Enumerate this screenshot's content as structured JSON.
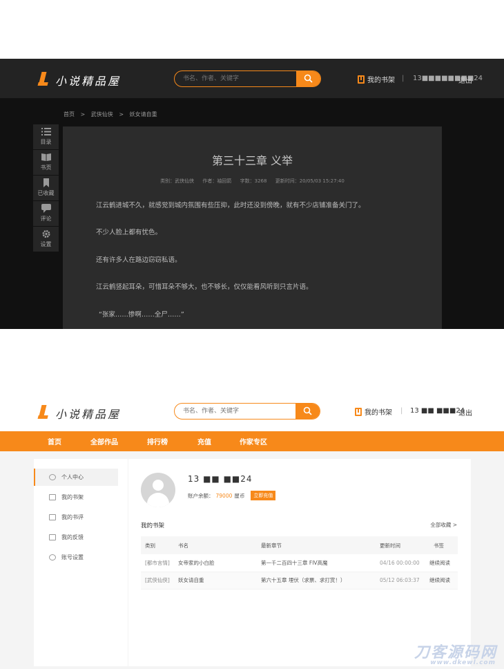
{
  "brand": {
    "name": "小说精品屋",
    "accent": "#f7891a",
    "dark_header_bg": "#232323",
    "dark_body_bg": "#111111"
  },
  "header": {
    "search_placeholder": "书名、作者、关键字",
    "search_icon": "search-icon",
    "shelf_label": "我的书架",
    "separator": "|",
    "user_dark": "13■■■■■■■■24",
    "user_light": "13 ■■ ■■■24",
    "logout_label": "退出"
  },
  "reader": {
    "breadcrumb": [
      "首页",
      ">",
      "武侠仙侠",
      ">",
      "妖女请自重"
    ],
    "tools": [
      {
        "label": "目录",
        "icon": "list-icon"
      },
      {
        "label": "书页",
        "icon": "book-icon"
      },
      {
        "label": "已收藏",
        "icon": "bookmark-icon"
      },
      {
        "label": "评论",
        "icon": "comment-icon"
      },
      {
        "label": "设置",
        "icon": "gear-icon"
      }
    ],
    "chapter_title": "第三十三章 义举",
    "meta": {
      "category": "类别：武侠仙侠",
      "author": "作者：袖回箭",
      "words": "字数：3268",
      "updated": "更新时间：20/05/03 15:27:40"
    },
    "paragraphs": [
      "江云鹤进城不久，就感觉到城内氛围有些压抑，此时还没到傍晚，就有不少店铺准备关门了。",
      "不少人脸上都有忧色。",
      "还有许多人在路边窃窃私语。",
      "江云鹤竖起耳朵，可惜耳朵不够大，也不够长，仅仅能看风听到只言片语。",
      "“张家……惨啊……全尸……”"
    ]
  },
  "nav": {
    "items": [
      "首页",
      "全部作品",
      "排行榜",
      "充值",
      "作家专区"
    ]
  },
  "user_center": {
    "menu": [
      {
        "label": "个人中心",
        "icon": "user-icon"
      },
      {
        "label": "我的书架",
        "icon": "shelf-icon"
      },
      {
        "label": "我的书评",
        "icon": "review-icon"
      },
      {
        "label": "我的反馈",
        "icon": "mail-icon"
      },
      {
        "label": "账号设置",
        "icon": "gear-icon"
      }
    ],
    "username": "13 ■■ ■■24",
    "balance_label": "账户余额：",
    "balance_amount": "79000",
    "balance_unit": "屋币",
    "recharge_label": "立即充值",
    "shelf_title": "我的书架",
    "shelf_more": "全部收藏 >",
    "columns": [
      "类别",
      "书名",
      "最新章节",
      "更新时间",
      "书签"
    ],
    "rows": [
      {
        "category": "[都市言情]",
        "name": "女帝家的小白脸",
        "chapter": "第一千二百四十三章 FIV高魔",
        "time": "04/16 00:00:00",
        "action": "继续阅读"
      },
      {
        "category": "[武侠仙侠]",
        "name": "妖女请自重",
        "chapter": "第六十五章 埋伏（求票、求打赏！）",
        "time": "05/12 06:03:37",
        "action": "继续阅读"
      }
    ]
  },
  "watermark": {
    "big": "刀客源码网",
    "small": "www.dkewl.com"
  }
}
